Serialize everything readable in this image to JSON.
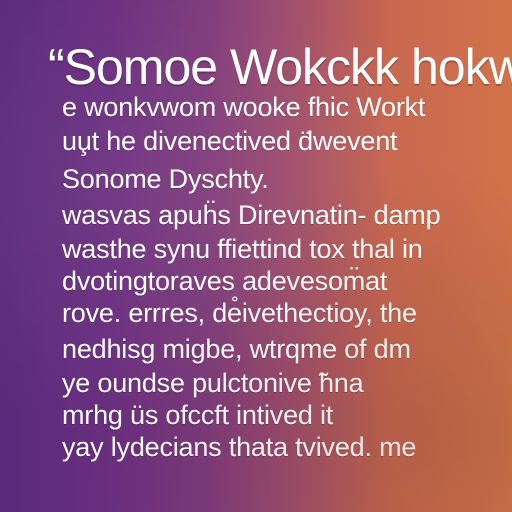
{
  "background": {
    "colors": [
      "#5a2a7c",
      "#6a2e7f",
      "#7e3a7b",
      "#a24f6b",
      "#c8674f",
      "#d2734a"
    ]
  },
  "headline": "“Somoe Wokckk hokw",
  "lines": [
    "e wonkvwom wooke fhic Workt",
    "uu̧t he divenectived d̈wevent",
    "Sonome Dyschty.",
    "wasvas apuḧs Direvnatin- damp",
    "wasthe synu ffiettind tox thal in",
    "dvotingtoraves adevesom̈at",
    "rove. errres, de̊ivethectioy, the",
    "nedhisg migbe, wtrqme of dm",
    "ye oundse pulctonive ̃hna",
    "mrhg üs ofccft intived it",
    "yay lydecians thata tvived. me"
  ]
}
